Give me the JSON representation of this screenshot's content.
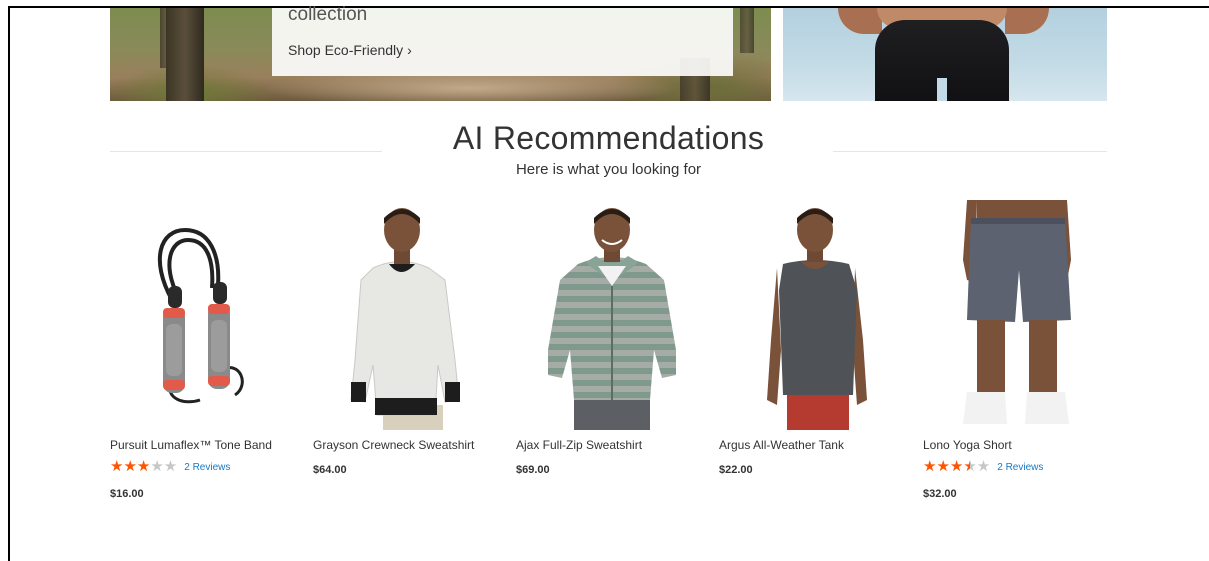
{
  "hero": {
    "left": {
      "title": "collection",
      "link_label": "Shop Eco-Friendly",
      "link_chevron": "›"
    }
  },
  "section": {
    "title": "AI Recommendations",
    "subtitle": "Here is what you looking for"
  },
  "products": [
    {
      "name": "Pursuit Lumaflex™ Tone Band",
      "rating": 3,
      "rating_max": 5,
      "reviews": "2  Reviews",
      "price": "$16.00",
      "image_icon": "jump-rope-image"
    },
    {
      "name": "Grayson Crewneck Sweatshirt",
      "price": "$64.00",
      "image_icon": "crewneck-sweatshirt-image"
    },
    {
      "name": "Ajax Full-Zip Sweatshirt",
      "price": "$69.00",
      "image_icon": "striped-hoodie-image"
    },
    {
      "name": "Argus All-Weather Tank",
      "price": "$22.00",
      "image_icon": "tank-top-image"
    },
    {
      "name": "Lono Yoga Short",
      "rating": 3.5,
      "rating_max": 5,
      "reviews": "2  Reviews",
      "price": "$32.00",
      "image_icon": "yoga-shorts-image"
    }
  ],
  "colors": {
    "star": "#ff5501",
    "star_empty": "#c7c7c7",
    "link": "#1979c3",
    "text": "#333333"
  }
}
